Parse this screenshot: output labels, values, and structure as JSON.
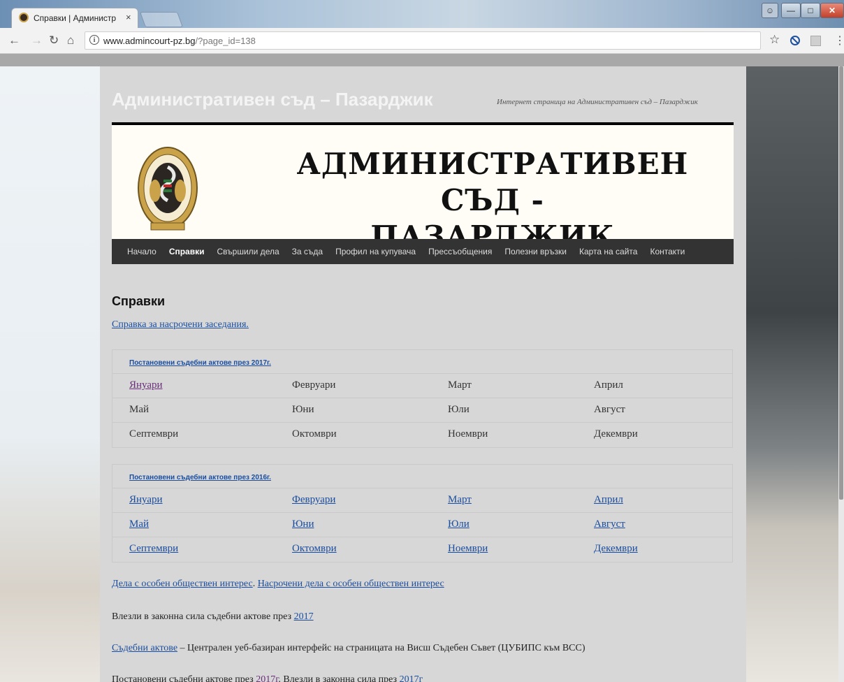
{
  "browser": {
    "tab_title": "Справки | Администрат",
    "tab_close": "×",
    "url_host": "www.admincourt-pz.bg",
    "url_path": "/?page_id=138",
    "icons": [
      "back-arrow-icon",
      "forward-arrow-icon",
      "reload-icon",
      "home-icon",
      "info-icon",
      "star-icon",
      "block-icon",
      "extension-icon",
      "menu-icon"
    ]
  },
  "site": {
    "title": "Административен съд – Пазарджик",
    "description": "Интернет страница на Административен съд – Пазарджик",
    "banner_line1": "АДМИНИСТРАТИВЕН СЪД -",
    "banner_line2": "ПАЗАРДЖИК",
    "seal_text": "АДМИНИСТРАТИВЕН СЪД - ПАЗАРДЖИК"
  },
  "nav": {
    "items": [
      "Начало",
      "Справки",
      "Свършили дела",
      "За съда",
      "Профил на купувача",
      "Прессъобщения",
      "Полезни връзки",
      "Карта на сайта",
      "Контакти"
    ],
    "active": "Справки"
  },
  "main": {
    "heading": "Справки",
    "hearings_link": "Справка за насрочени заседания.",
    "table2017": {
      "caption": "Постановени съдебни актове през 2017г.",
      "rows": [
        [
          "Януари",
          "Февруари",
          "Март",
          "Април"
        ],
        [
          "Май",
          "Юни",
          "Юли",
          "Август"
        ],
        [
          "Септември",
          "Октомври",
          "Ноември",
          "Декември"
        ]
      ]
    },
    "table2016": {
      "caption": "Постановени съдебни актове през 2016г.",
      "rows": [
        [
          "Януари",
          "Февруари",
          "Март",
          "Април"
        ],
        [
          "Май",
          "Юни",
          "Юли",
          "Август"
        ],
        [
          "Септември",
          "Октомври",
          "Ноември",
          "Декември"
        ]
      ]
    },
    "public_interest_link": "Дела с особен обществен интерес",
    "public_interest_sep": ". ",
    "scheduled_public_link": "Насрочени дела с особен обществен интерес",
    "final_acts_text": "Влезли в законна сила съдебни актове през ",
    "final_acts_year": "2017",
    "judicial_acts_link": "Съдебни актове",
    "judicial_acts_text": " – Централен уеб-базиран интерфейс на страницата на Висш Съдебен Съвет (ЦУБИПС към ВСС)",
    "bottom_text1": "Постановени съдебни актове през ",
    "bottom_link1": "2017г",
    "bottom_text2": ". Влезли в законна сила през ",
    "bottom_link2": "2017г"
  },
  "colors": {
    "link": "#1a4d9e",
    "visited": "#6a2e7a",
    "nav_bg": "#333333",
    "content_bg": "#d7d7d7"
  }
}
